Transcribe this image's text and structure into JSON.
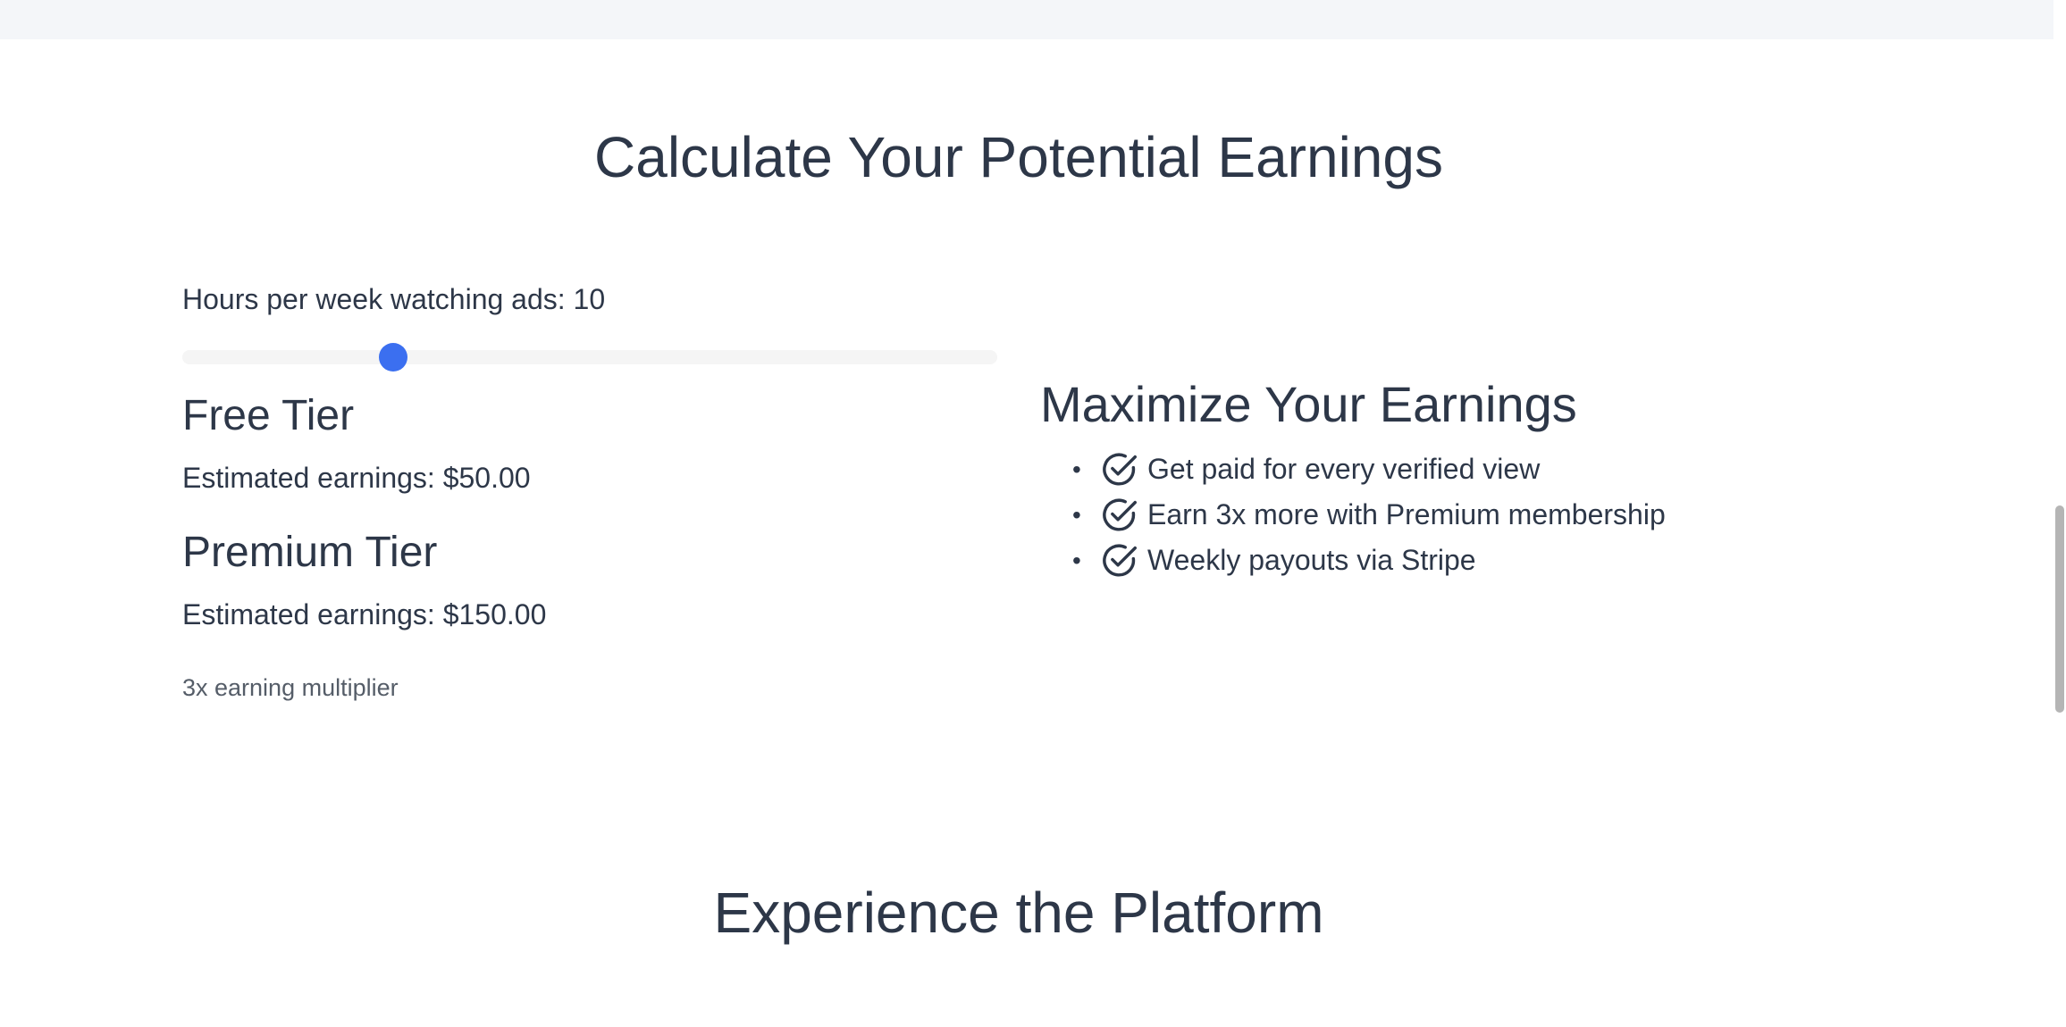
{
  "calculator": {
    "title": "Calculate Your Potential Earnings",
    "slider": {
      "label_prefix": "Hours per week watching ads: ",
      "value": 10,
      "min": 0,
      "max": 40
    },
    "free_tier": {
      "heading": "Free Tier",
      "earnings_text": "Estimated earnings: $50.00"
    },
    "premium_tier": {
      "heading": "Premium Tier",
      "earnings_text": "Estimated earnings: $150.00",
      "multiplier_note": "3x earning multiplier"
    }
  },
  "benefits": {
    "title": "Maximize Your Earnings",
    "items": [
      {
        "label": "Get paid for every verified view",
        "icon": "check-circle-icon"
      },
      {
        "label": "Earn 3x more with Premium membership",
        "icon": "check-circle-icon"
      },
      {
        "label": "Weekly payouts via Stripe",
        "icon": "check-circle-icon"
      }
    ]
  },
  "next_section": {
    "title": "Experience the Platform"
  },
  "colors": {
    "accent": "#3b6ff0",
    "text": "#2d3748",
    "muted": "#555d68"
  }
}
